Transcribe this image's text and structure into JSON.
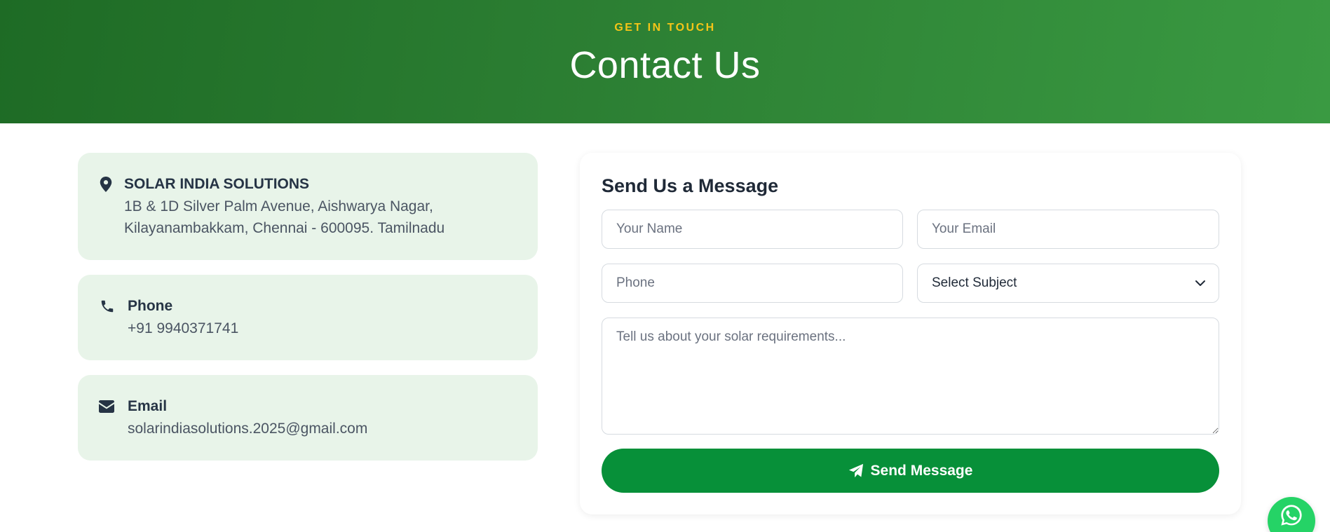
{
  "hero": {
    "eyebrow": "GET IN TOUCH",
    "title": "Contact Us"
  },
  "contact": {
    "address": {
      "icon": "map-marker-icon",
      "title": "SOLAR INDIA SOLUTIONS",
      "text": "1B & 1D Silver Palm Avenue, Aishwarya Nagar, Kilayanambakkam, Chennai - 600095. Tamilnadu"
    },
    "phone": {
      "icon": "phone-icon",
      "title": "Phone",
      "text": "+91 9940371741"
    },
    "email": {
      "icon": "envelope-icon",
      "title": "Email",
      "text": "solarindiasolutions.2025@gmail.com"
    }
  },
  "form": {
    "title": "Send Us a Message",
    "name_placeholder": "Your Name",
    "email_placeholder": "Your Email",
    "phone_placeholder": "Phone",
    "subject_selected": "Select Subject",
    "message_placeholder": "Tell us about your solar requirements...",
    "submit_label": "Send Message",
    "submit_icon": "paper-plane-icon"
  },
  "floating": {
    "whatsapp_icon": "whatsapp-icon"
  },
  "colors": {
    "hero_start": "#1e6b25",
    "hero_end": "#3a9a42",
    "eyebrow": "#f5c518",
    "card_bg": "#e8f4e9",
    "button": "#079039",
    "whatsapp": "#25d366"
  }
}
